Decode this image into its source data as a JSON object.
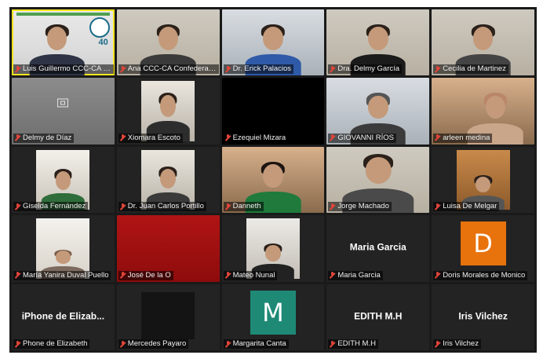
{
  "colors": {
    "active_border": "#f5e41d",
    "muted_mic": "#e0453a",
    "avatar_orange": "#e8720c",
    "avatar_teal": "#1e8a76"
  },
  "participants": [
    {
      "name": "Luis Guillermo CCC-CA Con...",
      "tile": "office",
      "active": true
    },
    {
      "name": "Ana CCC-CA Confederac...",
      "tile": "room"
    },
    {
      "name": "Dr. Erick Palacios",
      "tile": "room2"
    },
    {
      "name": "Dra. Delmy García",
      "tile": "room"
    },
    {
      "name": "Cecilia de Martinez",
      "tile": "room"
    },
    {
      "name": "Delmy de Díaz",
      "tile": "gray"
    },
    {
      "name": "Xiomara Escoto",
      "tile": "dark-frame"
    },
    {
      "name": "Ezequiel Mizara",
      "tile": "dark"
    },
    {
      "name": "GIOVANNI RÍOS",
      "tile": "room2"
    },
    {
      "name": "arleen medina",
      "tile": "warm"
    },
    {
      "name": "Giselda Fernández",
      "tile": "dark-frame"
    },
    {
      "name": "Dr. Juan Carlos Portillo",
      "tile": "green-frame"
    },
    {
      "name": "Danneth",
      "tile": "warm"
    },
    {
      "name": "Jorge Machado",
      "tile": "room"
    },
    {
      "name": "Luisa De Melgar",
      "tile": "dark-frame"
    },
    {
      "name": "María Yanira Duval Puello",
      "tile": "dark-frame"
    },
    {
      "name": "José De la O",
      "tile": "red"
    },
    {
      "name": "Mateo Nunal",
      "tile": "dark-frame"
    },
    {
      "name": "Maria Garcia",
      "tile": "name-only",
      "display_name": "Maria Garcia"
    },
    {
      "name": "Doris Morales de Monico",
      "tile": "avatar",
      "avatar_letter": "D",
      "avatar_color": "#e8720c"
    },
    {
      "name": "Phone de Elizabeth",
      "tile": "name-only",
      "display_name": "iPhone de Elizab..."
    },
    {
      "name": "Mercedes Payaro",
      "tile": "dark-small"
    },
    {
      "name": "Margarita Canta",
      "tile": "avatar",
      "avatar_letter": "M",
      "avatar_color": "#1e8a76"
    },
    {
      "name": "EDITH M.H",
      "tile": "name-only",
      "display_name": "EDITH M.H"
    },
    {
      "name": "Iris Vilchez",
      "tile": "name-only",
      "display_name": "Iris Vilchez"
    }
  ]
}
